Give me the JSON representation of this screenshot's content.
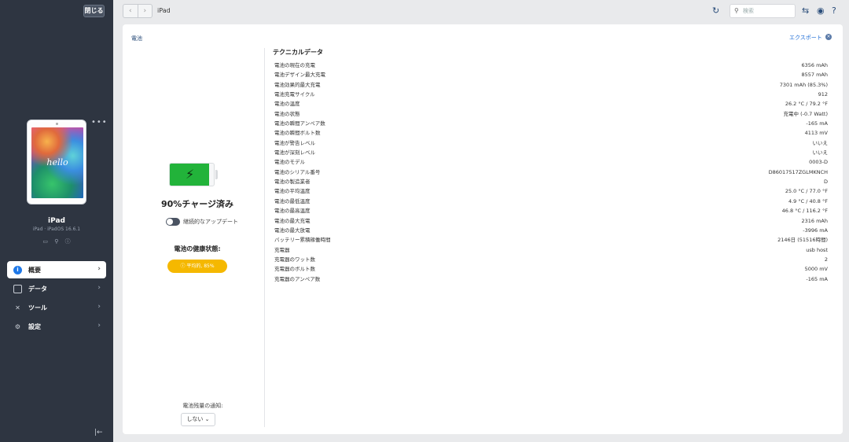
{
  "sidebar": {
    "close_label": "閉じる",
    "device_screen_text": "hello",
    "device_name": "iPad",
    "device_sub": "iPad · iPadOS 16.6.1",
    "nav": [
      {
        "label": "概要",
        "icon": "info-icon",
        "active": true
      },
      {
        "label": "データ",
        "icon": "data-icon",
        "active": false
      },
      {
        "label": "ツール",
        "icon": "tools-icon",
        "active": false
      },
      {
        "label": "設定",
        "icon": "gear-icon",
        "active": false
      }
    ]
  },
  "topbar": {
    "breadcrumb": "iPad",
    "search_placeholder": "検索"
  },
  "panel": {
    "title": "電池",
    "export_label": "エクスポート",
    "charge_text": "90%チャージ済み",
    "charge_percent": 90,
    "toggle_label": "継続的なアップデート",
    "health_label": "電池の健康状態:",
    "health_badge": "平均的, 85%",
    "notify_label": "電池残量の通知:",
    "notify_value": "しない"
  },
  "tech": {
    "title": "テクニカルデータ",
    "rows": [
      {
        "k": "電池の現在の充電",
        "v": "6356 mAh"
      },
      {
        "k": "電池デザイン最大充電",
        "v": "8557 mAh"
      },
      {
        "k": "電池効果的最大充電",
        "v": "7301 mAh (85.3%)"
      },
      {
        "k": "電池充電サイクル",
        "v": "912"
      },
      {
        "k": "電池の温度",
        "v": "26.2 °C / 79.2 °F"
      },
      {
        "k": "電池の状態",
        "v": "充電中 (-0.7 Watt)"
      },
      {
        "k": "電池の瞬間アンペア数",
        "v": "-165 mA"
      },
      {
        "k": "電池の瞬間ボルト数",
        "v": "4113 mV"
      },
      {
        "k": "電池が警告レベル",
        "v": "いいえ"
      },
      {
        "k": "電池が深刻レベル",
        "v": "いいえ"
      },
      {
        "k": "電池のモデル",
        "v": "0003-D"
      },
      {
        "k": "電池のシリアル番号",
        "v": "D86017517ZGLMKNCH"
      },
      {
        "k": "電池の製造業者",
        "v": "D"
      },
      {
        "k": "電池の平均温度",
        "v": "25.0 °C / 77.0 °F"
      },
      {
        "k": "電池の最低温度",
        "v": "4.9 °C / 40.8 °F"
      },
      {
        "k": "電池の最高温度",
        "v": "46.8 °C / 116.2 °F"
      },
      {
        "k": "電池の最大充電",
        "v": "2316 mAh"
      },
      {
        "k": "電池の最大放電",
        "v": "-3996 mA"
      },
      {
        "k": "バッテリー累積稼働時間",
        "v": "2146日 (51516時間)"
      },
      {
        "k": "充電器",
        "v": "usb host"
      },
      {
        "k": "充電器のワット数",
        "v": "2"
      },
      {
        "k": "充電器のボルト数",
        "v": "5000 mV"
      },
      {
        "k": "充電器のアンペア数",
        "v": "-165 mA"
      }
    ]
  }
}
